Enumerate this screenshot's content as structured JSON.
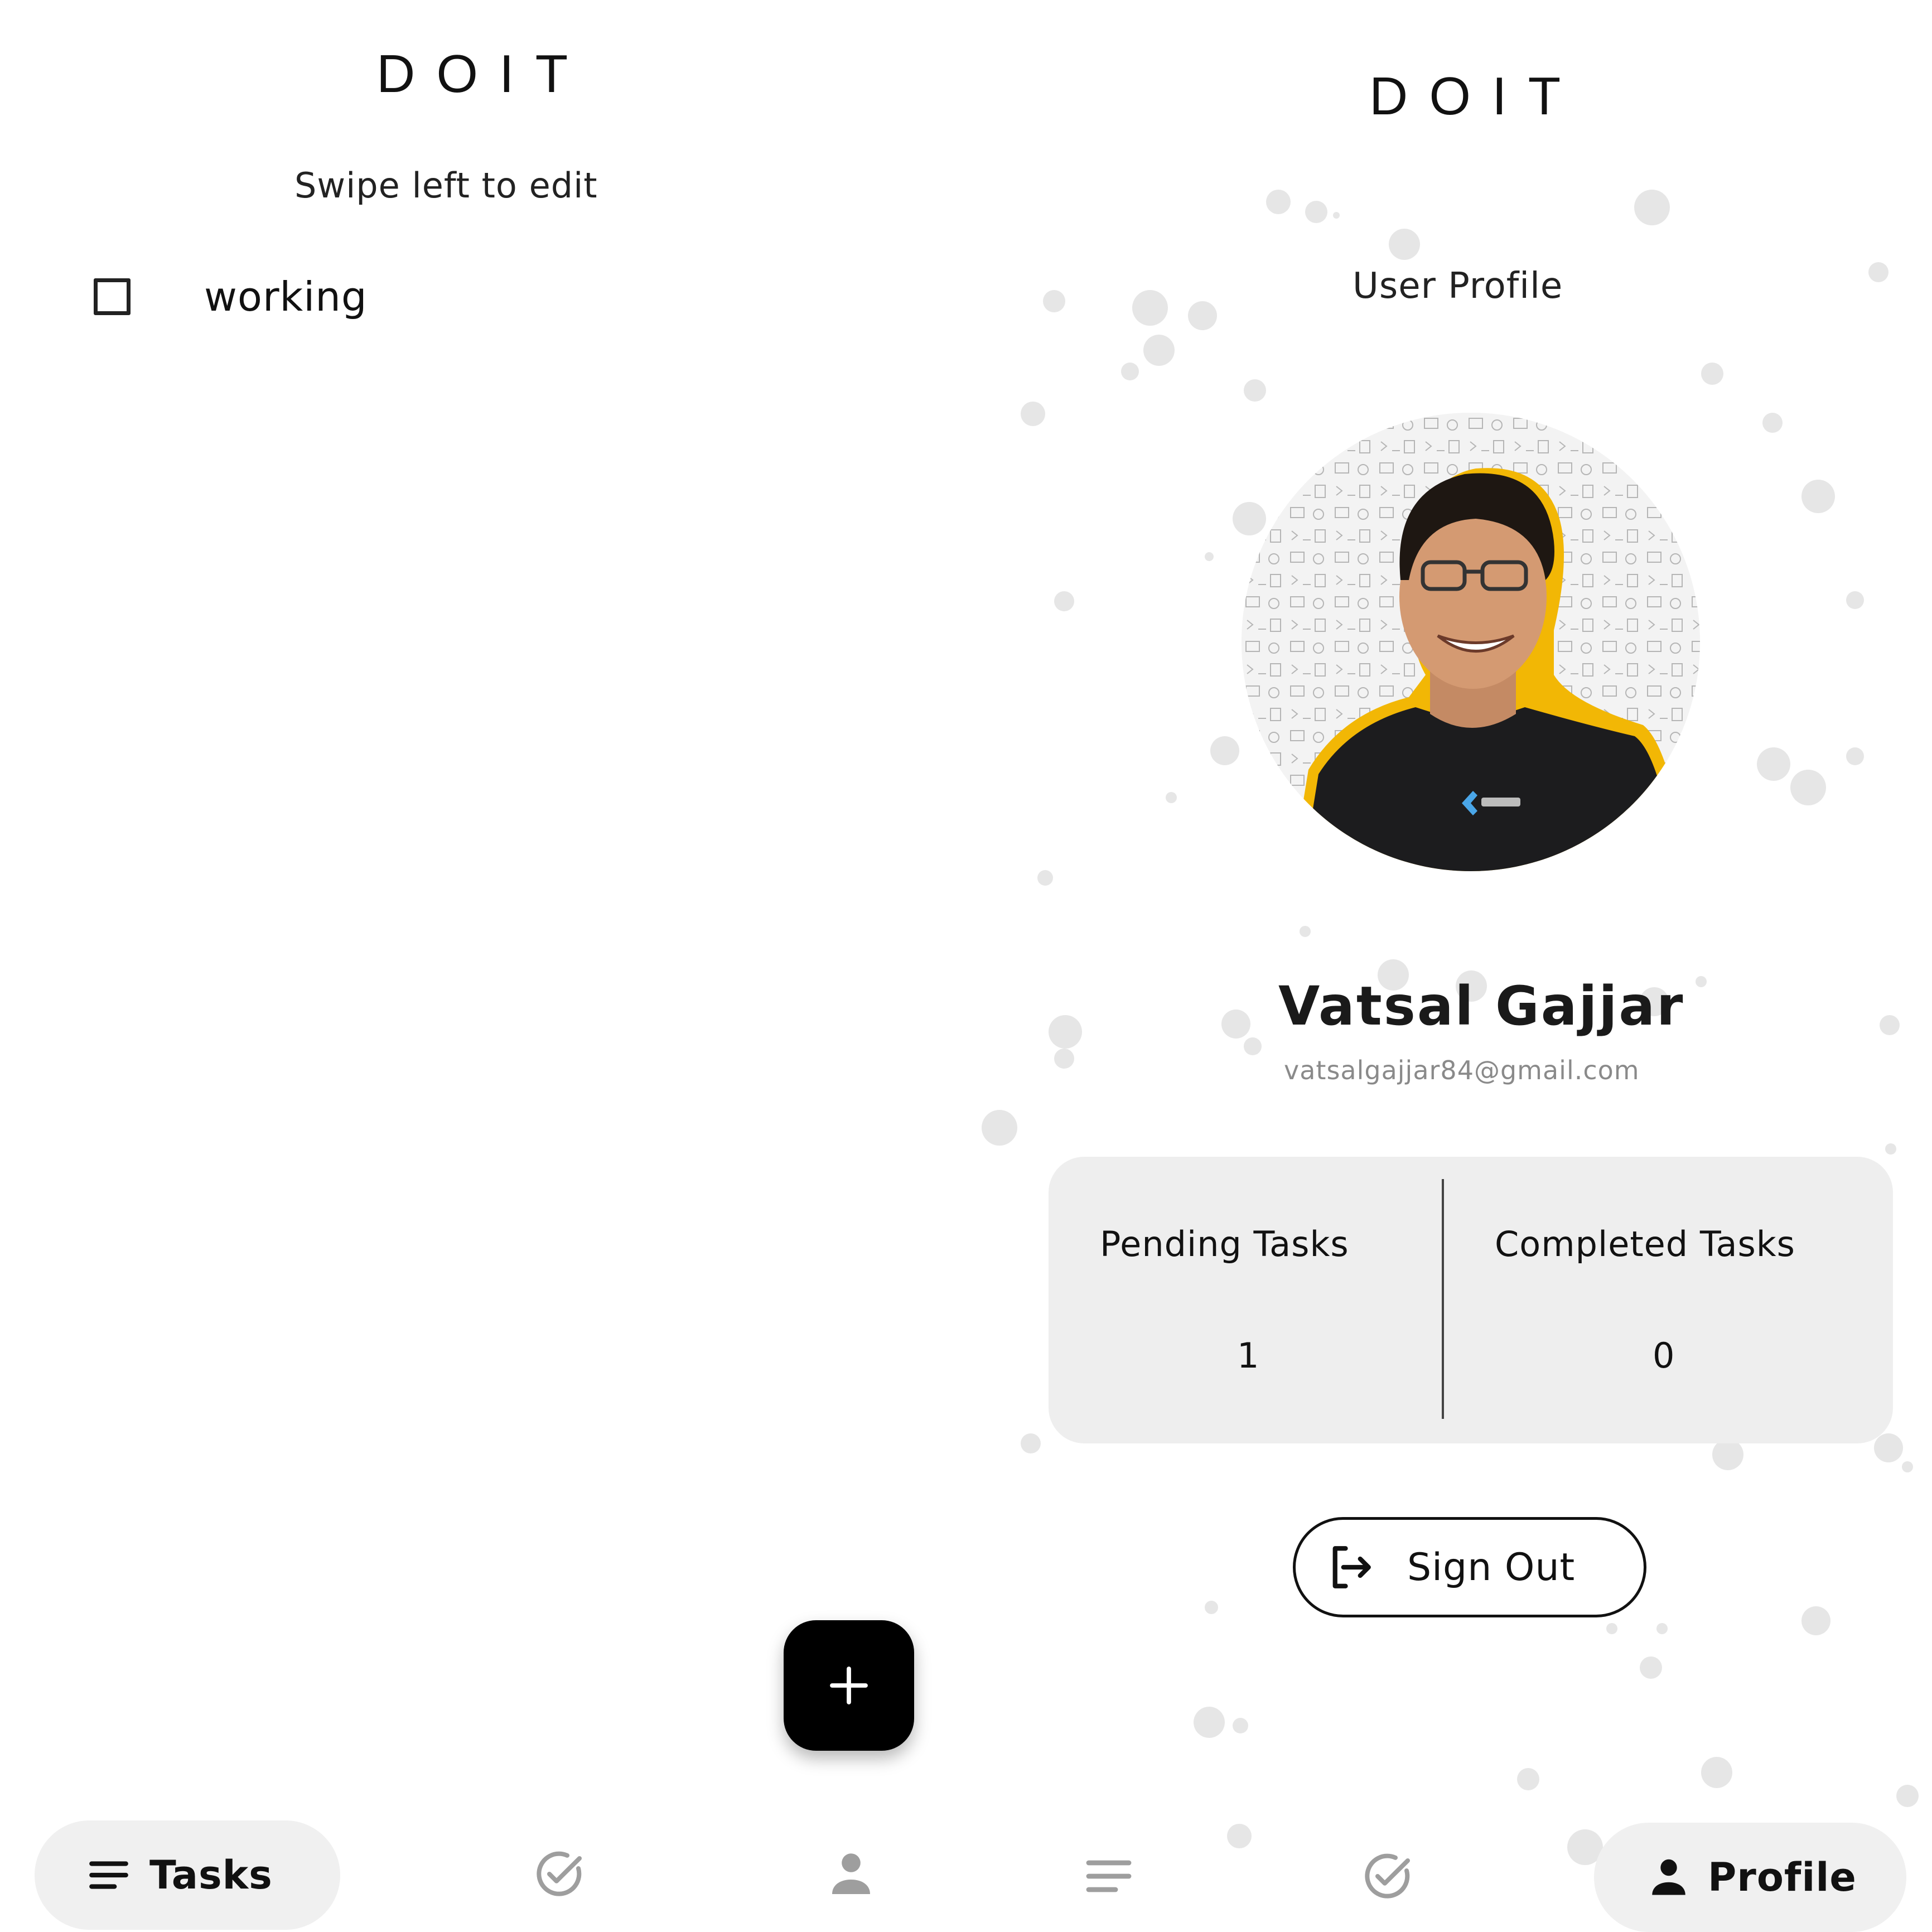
{
  "left_screen": {
    "app_name": "DOIT",
    "hint": "Swipe left to edit",
    "tasks": [
      {
        "title": "working",
        "completed": false
      }
    ],
    "fab_icon": "plus-icon",
    "bottom_nav": {
      "active_label": "Tasks",
      "items": [
        "list-icon",
        "check-circle-icon",
        "person-icon"
      ]
    }
  },
  "right_screen": {
    "app_name": "DOIT",
    "heading": "User Profile",
    "user": {
      "name": "Vatsal Gajjar",
      "email": "vatsalgajjar84@gmail.com"
    },
    "stats": {
      "pending_label": "Pending Tasks",
      "pending_value": "1",
      "completed_label": "Completed Tasks",
      "completed_value": "0"
    },
    "sign_out_label": "Sign Out",
    "bottom_nav": {
      "active_label": "Profile",
      "items": [
        "list-icon",
        "check-circle-icon",
        "person-icon"
      ]
    }
  },
  "colors": {
    "background": "#ffffff",
    "card": "#eeeeee",
    "fab": "#000000",
    "text": "#111111",
    "muted_text": "#8a8a8a",
    "inactive_icon": "#9e9e9e",
    "avatar_outline": "#f2b705"
  }
}
